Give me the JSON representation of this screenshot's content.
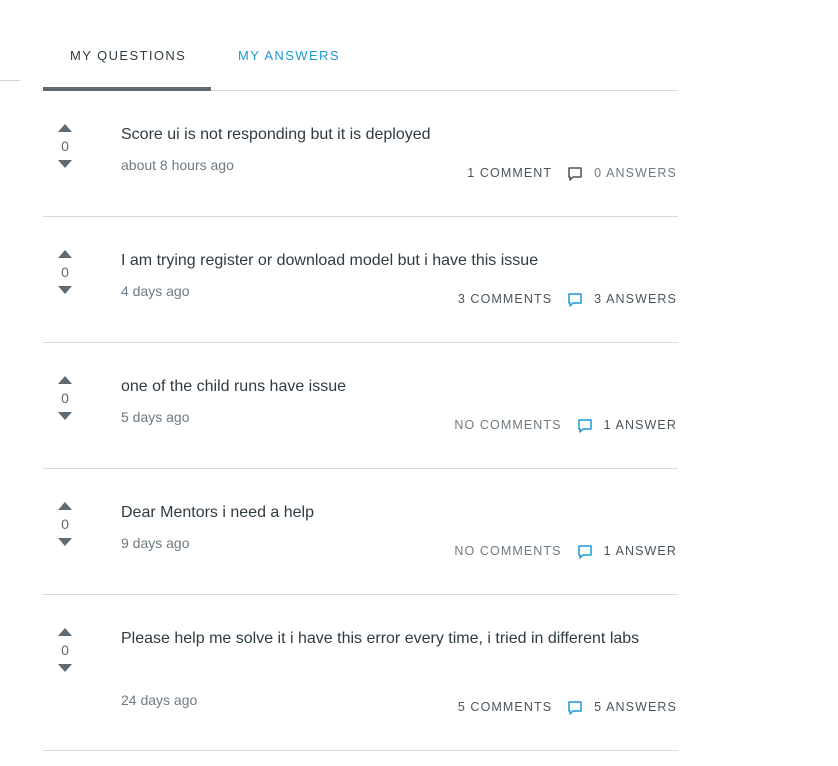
{
  "tabs": {
    "my_questions": "MY QUESTIONS",
    "my_answers": "MY ANSWERS"
  },
  "colors": {
    "active_tab": "#2f3b43",
    "inactive_tab": "#1a9ad6",
    "icon_blue": "#1a9ad6",
    "icon_gray": "#4a545b"
  },
  "questions": [
    {
      "score": "0",
      "title": "Score ui is not responding but it is deployed",
      "date": "about 8 hours ago",
      "comments": "1 COMMENT",
      "answers": "0 ANSWERS"
    },
    {
      "score": "0",
      "title": "I am trying register or download model but i have this issue",
      "date": "4 days ago",
      "comments": "3 COMMENTS",
      "answers": "3 ANSWERS"
    },
    {
      "score": "0",
      "title": "one of the child runs have issue",
      "date": "5 days ago",
      "comments": "NO COMMENTS",
      "answers": "1 ANSWER"
    },
    {
      "score": "0",
      "title": "Dear Mentors i need a help",
      "date": "9 days ago",
      "comments": "NO COMMENTS",
      "answers": "1 ANSWER"
    },
    {
      "score": "0",
      "title": "Please help me solve it i have this error every time, i tried in different labs",
      "date": "24 days ago",
      "comments": "5 COMMENTS",
      "answers": "5 ANSWERS"
    }
  ]
}
